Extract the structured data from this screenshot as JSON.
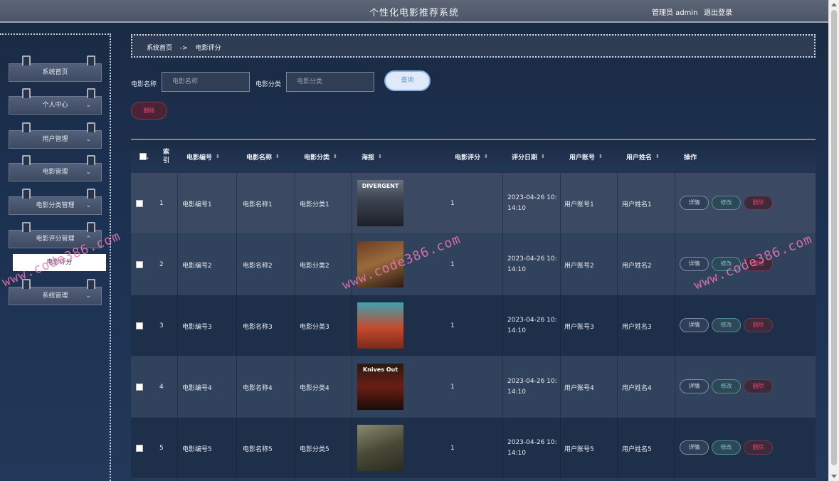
{
  "header": {
    "title": "个性化电影推荐系统",
    "user": "管理员 admin",
    "logout": "退出登录"
  },
  "sidebar": {
    "items": [
      {
        "label": "系统首页",
        "chevron": ""
      },
      {
        "label": "个人中心",
        "chevron": "⌄"
      },
      {
        "label": "用户管理",
        "chevron": "⌄"
      },
      {
        "label": "电影管理",
        "chevron": "⌄"
      },
      {
        "label": "电影分类管理",
        "chevron": "⌄"
      },
      {
        "label": "电影评分管理",
        "chevron": "⌃"
      },
      {
        "label": "系统管理",
        "chevron": "⌄"
      }
    ],
    "active_sub": "电影评分"
  },
  "breadcrumb": {
    "home": "系统首页",
    "sep": "->",
    "current": "电影评分"
  },
  "search": {
    "name_label": "电影名称",
    "name_placeholder": "电影名称",
    "category_label": "电影分类",
    "category_placeholder": "电影分类",
    "query_btn": "查询",
    "delete_btn": "删除"
  },
  "table": {
    "headers": {
      "index": "索引",
      "movie_no": "电影编号",
      "movie_name": "电影名称",
      "category": "电影分类",
      "poster": "海报",
      "rating": "电影评分",
      "date": "评分日期",
      "account": "用户账号",
      "username": "用户姓名",
      "ops": "操作",
      "sort_icon": "⇕"
    },
    "rows": [
      {
        "idx": "1",
        "no": "电影编号1",
        "name": "电影名称1",
        "cat": "电影分类1",
        "poster_text": "DIVERGENT",
        "rating": "1",
        "date1": "2023-04-26 10:",
        "date2": "14:10",
        "account": "用户账号1",
        "uname": "用户姓名1"
      },
      {
        "idx": "2",
        "no": "电影编号2",
        "name": "电影名称2",
        "cat": "电影分类2",
        "poster_text": "",
        "rating": "1",
        "date1": "2023-04-26 10:",
        "date2": "14:10",
        "account": "用户账号2",
        "uname": "用户姓名2"
      },
      {
        "idx": "3",
        "no": "电影编号3",
        "name": "电影名称3",
        "cat": "电影分类3",
        "poster_text": "",
        "rating": "1",
        "date1": "2023-04-26 10:",
        "date2": "14:10",
        "account": "用户账号3",
        "uname": "用户姓名3"
      },
      {
        "idx": "4",
        "no": "电影编号4",
        "name": "电影名称4",
        "cat": "电影分类4",
        "poster_text": "Knives Out",
        "rating": "1",
        "date1": "2023-04-26 10:",
        "date2": "14:10",
        "account": "用户账号4",
        "uname": "用户姓名4"
      },
      {
        "idx": "5",
        "no": "电影编号5",
        "name": "电影名称5",
        "cat": "电影分类5",
        "poster_text": "",
        "rating": "1",
        "date1": "2023-04-26 10:",
        "date2": "14:10",
        "account": "用户账号5",
        "uname": "用户姓名5"
      }
    ],
    "op_labels": {
      "detail": "详情",
      "edit": "修改",
      "delete": "删除"
    }
  },
  "watermark": "www.code386.com"
}
